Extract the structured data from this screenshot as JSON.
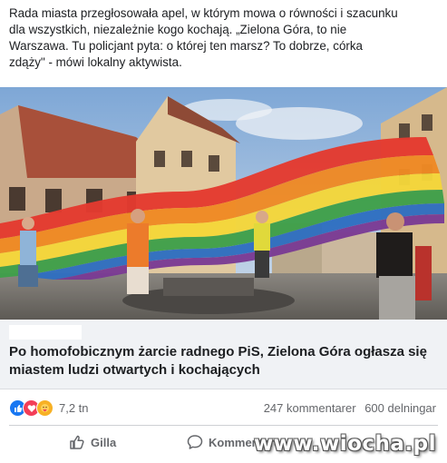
{
  "post": {
    "text_lines": [
      "Rada miasta przegłosowała apel, w którym mowa o równości i szacunku",
      "dla wszystkich, niezależnie kogo kochają. „Zielona Góra, to nie",
      "Warszawa. Tu policjant pyta: o której ten marsz? To dobrze, córka",
      "zdąży\" - mówi                     lokalny aktywista."
    ]
  },
  "link": {
    "title": "Po homofobicznym żarcie radnego PiS, Zielona Góra ogłasza się miastem ludzi otwartych i kochających"
  },
  "stats": {
    "reaction_icons": [
      "like-icon",
      "love-icon",
      "care-icon"
    ],
    "reaction_count": "7,2 tn",
    "comments": "247 kommentarer",
    "shares": "600 delningar"
  },
  "actions": {
    "like_label": "Gilla",
    "comment_label": "Kommentera"
  },
  "watermark": "www.wiocha.pl",
  "colors": {
    "like": "#1877f2",
    "love": "#f33e58",
    "care": "#f7b125",
    "muted_text": "#65676b",
    "link_bg": "#f0f2f5"
  }
}
